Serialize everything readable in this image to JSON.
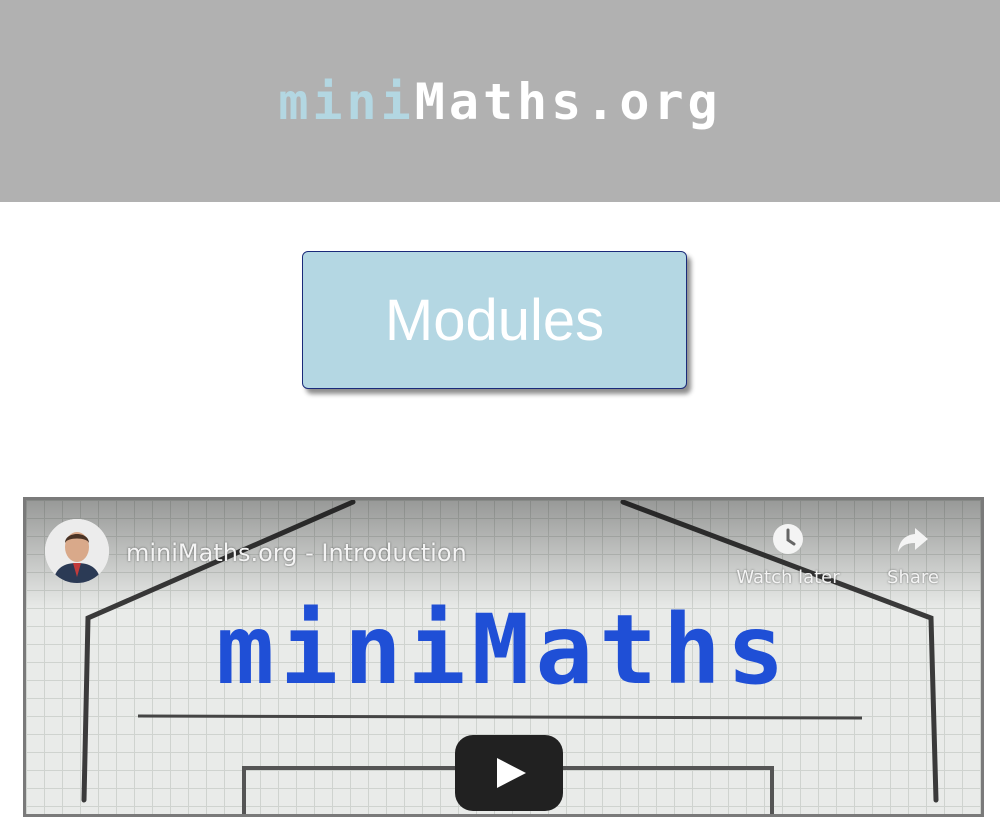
{
  "header": {
    "title_prefix": "mini",
    "title_suffix": "Maths.org"
  },
  "main": {
    "modules_button": "Modules"
  },
  "video": {
    "title": "miniMaths.org - Introduction",
    "watch_later_label": "Watch later",
    "share_label": "Share",
    "artwork_text": "miniMaths",
    "play_icon": "play-icon",
    "watch_later_icon": "clock-icon",
    "share_icon": "share-arrow-icon"
  },
  "colors": {
    "header_bg": "#b1b1b1",
    "title_mini": "#b3d7e2",
    "button_bg": "#b4d7e3",
    "button_border": "#1a2a7a",
    "artwork_text": "#1f4fd6"
  }
}
